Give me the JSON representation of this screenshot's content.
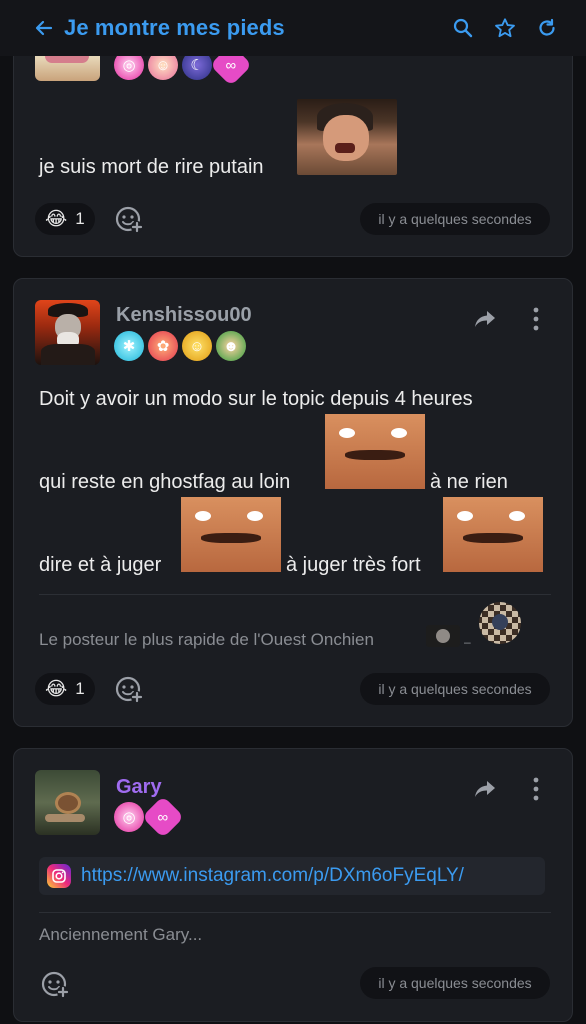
{
  "header": {
    "title": "Je montre mes pieds"
  },
  "posts": [
    {
      "message": {
        "line1": "je suis mort de rire putain"
      },
      "reaction": {
        "emoji": "😂",
        "count": "1"
      },
      "time": "il y a quelques secondes"
    },
    {
      "username": "Kenshissou00",
      "message": {
        "line1": "Doit y avoir un modo sur le topic depuis 4 heures",
        "line2a": "qui reste en ghostfag au loin",
        "line2b": "à ne rien",
        "line3a": "dire et à juger",
        "line3b": "à juger très fort"
      },
      "signature": "Le posteur le plus rapide de l'Ouest Onchien",
      "reaction": {
        "emoji": "😂",
        "count": "1"
      },
      "time": "il y a quelques secondes"
    },
    {
      "username": "Gary",
      "link": "https://www.instagram.com/p/DXm6oFyEqLY/",
      "signature": "Anciennement Gary...",
      "time": "il y a quelques secondes"
    }
  ],
  "colors": {
    "accent": "#3b9bf0",
    "username_gray": "#9aa0a8",
    "username_purple": "#a06cf0",
    "card_bg": "#1b1d22"
  }
}
